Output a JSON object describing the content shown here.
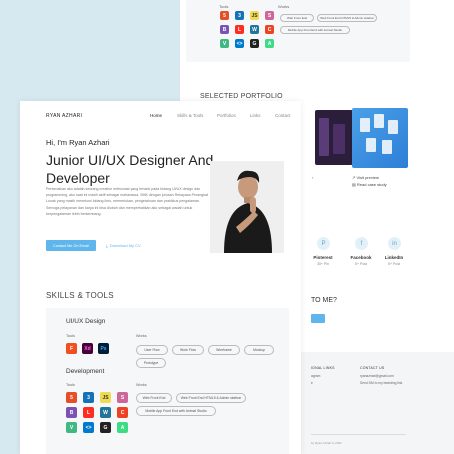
{
  "back": {
    "tools_label": "Tools",
    "works_label": "Works",
    "works_pills": [
      "Web Front End",
      "Web Front End HTML5 & Admin sidebar",
      "Mobile App Front End with Animal Studio"
    ],
    "selected_portfolio": "SELECTED PORTFOLIO",
    "portfolio_captions": [
      "Visit preview",
      "Read case study"
    ],
    "social": [
      {
        "icon": "P",
        "name": "Pinterest",
        "sub": "30+ Pin"
      },
      {
        "icon": "f",
        "name": "Facebook",
        "sub": "5+ Post"
      },
      {
        "icon": "in",
        "name": "LinkedIn",
        "sub": "5+ Post"
      }
    ],
    "hire_title": "TO ME?",
    "footer": {
      "col1_title": "IONAL LINKS",
      "col1_items": [
        "agram",
        "e"
      ],
      "col2_title": "CONTACT US",
      "col2_items": [
        "ryanazhari@gmail.com",
        "Send DM to my bearding link"
      ],
      "copyright": "by Ryan Azhari in 2021"
    }
  },
  "front": {
    "brand": "RYAN AZHARI",
    "nav": [
      "Home",
      "Skills & Tools",
      "Portfolios",
      "Links",
      "Contact"
    ],
    "greeting": "Hi, I'm Ryan Azhari",
    "headline": "Junior UI/UX Designer And Developer",
    "paragraph": "Perkenalkan aku adalah seorang creative enthusiast yang tertarik pada bidang UI/UX design dan programming, aku saat ini masih aktif sebagai mahasiswa, SMK dengan jurusan Rekayasa Perangkat Lunak yang masih menekuni bidang ilmu, memerlukan, pengetahuan dan praktikus pengalaman. Semoga pelayanan dan karya ini bisa diubah dan memperhatikan aku sebagai wadah untuk berpengalaman lebih berkembang.",
    "hire_button": "Contact Me On Email",
    "download_cv": "Download My CV",
    "skills_title": "SKILLS & TOOLS",
    "uiux": {
      "title": "UI/UX Design",
      "tools_label": "Tools",
      "works_label": "Works",
      "tools": [
        {
          "icon": "figma-icon",
          "glyph": "F",
          "color": "#f24e1e"
        },
        {
          "icon": "xd-icon",
          "glyph": "Xd",
          "color": "#470137"
        },
        {
          "icon": "photoshop-icon",
          "glyph": "Ps",
          "color": "#001e36"
        }
      ],
      "works": [
        "User Flow",
        "Work Flow",
        "Wireframe",
        "Mockup",
        "Prototype"
      ]
    },
    "development": {
      "title": "Development",
      "tools_label": "Tools",
      "works_label": "Works",
      "tools": [
        {
          "icon": "html5-icon",
          "glyph": "5",
          "color": "#e34f26"
        },
        {
          "icon": "css3-icon",
          "glyph": "3",
          "color": "#1572b6"
        },
        {
          "icon": "javascript-icon",
          "glyph": "JS",
          "color": "#f0db4f"
        },
        {
          "icon": "sass-icon",
          "glyph": "S",
          "color": "#cd6799"
        },
        {
          "icon": "bootstrap-icon",
          "glyph": "B",
          "color": "#7952b3"
        },
        {
          "icon": "laravel-icon",
          "glyph": "L",
          "color": "#ff2d20"
        },
        {
          "icon": "wordpress-icon",
          "glyph": "W",
          "color": "#21759b"
        },
        {
          "icon": "codeigniter-icon",
          "glyph": "C",
          "color": "#ee4323"
        },
        {
          "icon": "vue-icon",
          "glyph": "V",
          "color": "#41b883"
        },
        {
          "icon": "vscode-icon",
          "glyph": "<>",
          "color": "#007acc"
        },
        {
          "icon": "github-icon",
          "glyph": "G",
          "color": "#222222"
        },
        {
          "icon": "android-studio-icon",
          "glyph": "A",
          "color": "#3ddc84"
        }
      ],
      "works": [
        "Web Front End",
        "Web Front End HTML5 & Admin sidebar",
        "Mobile App Front End with Animal Studio"
      ]
    },
    "accent": "#5fb6ec"
  }
}
